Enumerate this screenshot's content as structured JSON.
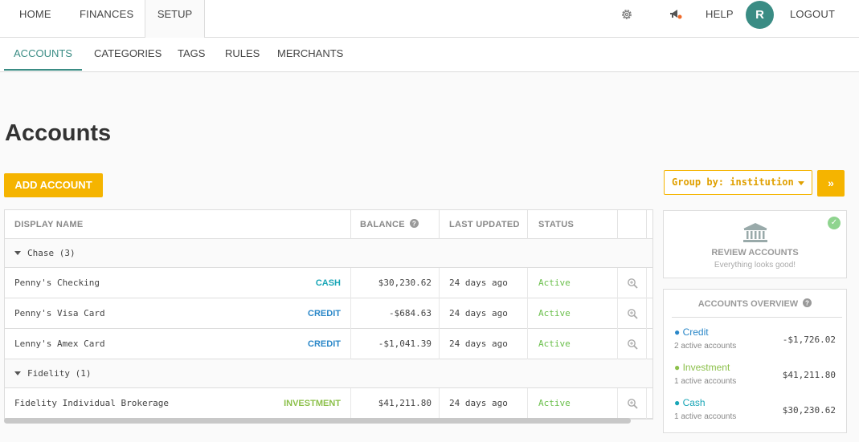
{
  "topnav": {
    "home": "HOME",
    "finances": "FINANCES",
    "setup": "SETUP",
    "help": "HELP",
    "avatar_initial": "R",
    "logout": "LOGOUT"
  },
  "subnav": {
    "accounts": "ACCOUNTS",
    "categories": "CATEGORIES",
    "tags": "TAGS",
    "rules": "RULES",
    "merchants": "MERCHANTS"
  },
  "page": {
    "title": "Accounts",
    "add_account": "ADD ACCOUNT",
    "group_by": "Group by: institution",
    "expand_label": "»"
  },
  "table": {
    "headers": {
      "display_name": "DISPLAY NAME",
      "balance": "BALANCE",
      "last_updated": "LAST UPDATED",
      "status": "STATUS"
    },
    "groups": [
      {
        "label": "Chase (3)",
        "rows": [
          {
            "name": "Penny's Checking",
            "type": "CASH",
            "type_color": "#1aa6b7",
            "balance": "$30,230.62",
            "updated": "24 days ago",
            "status": "Active"
          },
          {
            "name": "Penny's Visa Card",
            "type": "CREDIT",
            "type_color": "#2a87c8",
            "balance": "-$684.63",
            "updated": "24 days ago",
            "status": "Active"
          },
          {
            "name": "Lenny's Amex Card",
            "type": "CREDIT",
            "type_color": "#2a87c8",
            "balance": "-$1,041.39",
            "updated": "24 days ago",
            "status": "Active"
          }
        ]
      },
      {
        "label": "Fidelity (1)",
        "rows": [
          {
            "name": "Fidelity Individual Brokerage",
            "type": "INVESTMENT",
            "type_color": "#8cc04b",
            "balance": "$41,211.80",
            "updated": "24 days ago",
            "status": "Active"
          }
        ]
      }
    ]
  },
  "review": {
    "title": "REVIEW ACCOUNTS",
    "subtitle": "Everything looks good!"
  },
  "overview": {
    "title": "ACCOUNTS OVERVIEW",
    "items": [
      {
        "name": "Credit",
        "color": "#2a87c8",
        "count": "2 active accounts",
        "amount": "-$1,726.02"
      },
      {
        "name": "Investment",
        "color": "#8cc04b",
        "count": "1 active accounts",
        "amount": "$41,211.80"
      },
      {
        "name": "Cash",
        "color": "#1aa6b7",
        "count": "1 active accounts",
        "amount": "$30,230.62"
      }
    ]
  },
  "colors": {
    "accent": "#3a8c84",
    "button": "#f5b400",
    "status_active": "#6abf4b"
  }
}
